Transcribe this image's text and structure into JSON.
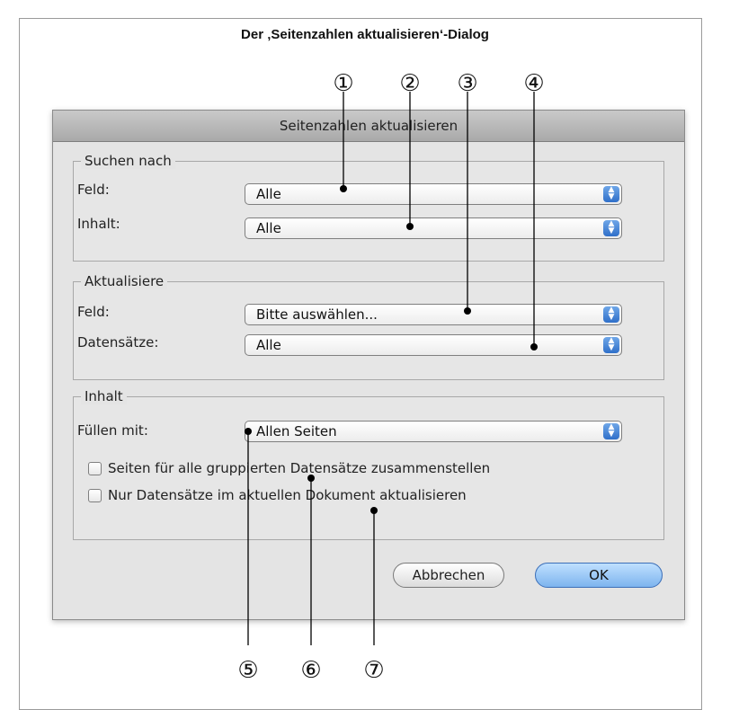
{
  "figure_title": "Der ‚Seitenzahlen aktualisieren‘-Dialog",
  "dialog": {
    "title": "Seitenzahlen aktualisieren",
    "groups": {
      "suchen_nach": {
        "legend": "Suchen nach",
        "rows": [
          {
            "label": "Feld:",
            "value": "Alle"
          },
          {
            "label": "Inhalt:",
            "value": "Alle"
          }
        ]
      },
      "aktualisiere": {
        "legend": "Aktualisiere",
        "rows": [
          {
            "label": "Feld:",
            "value": "Bitte auswählen..."
          },
          {
            "label": "Datensätze:",
            "value": "Alle"
          }
        ]
      },
      "inhalt": {
        "legend": "Inhalt",
        "rows": [
          {
            "label": "Füllen mit:",
            "value": "Allen Seiten"
          }
        ],
        "checkboxes": [
          {
            "label": "Seiten für alle gruppierten Datensätze zusammenstellen",
            "checked": false
          },
          {
            "label": "Nur Datensätze im aktuellen Dokument aktualisieren",
            "checked": false
          }
        ]
      }
    },
    "buttons": {
      "cancel": "Abbrechen",
      "ok": "OK"
    }
  },
  "callouts": [
    "①",
    "②",
    "③",
    "④",
    "⑤",
    "⑥",
    "⑦"
  ],
  "colors": {
    "ok_button": "#7db4ee",
    "stepper": "#2f6fc9"
  }
}
